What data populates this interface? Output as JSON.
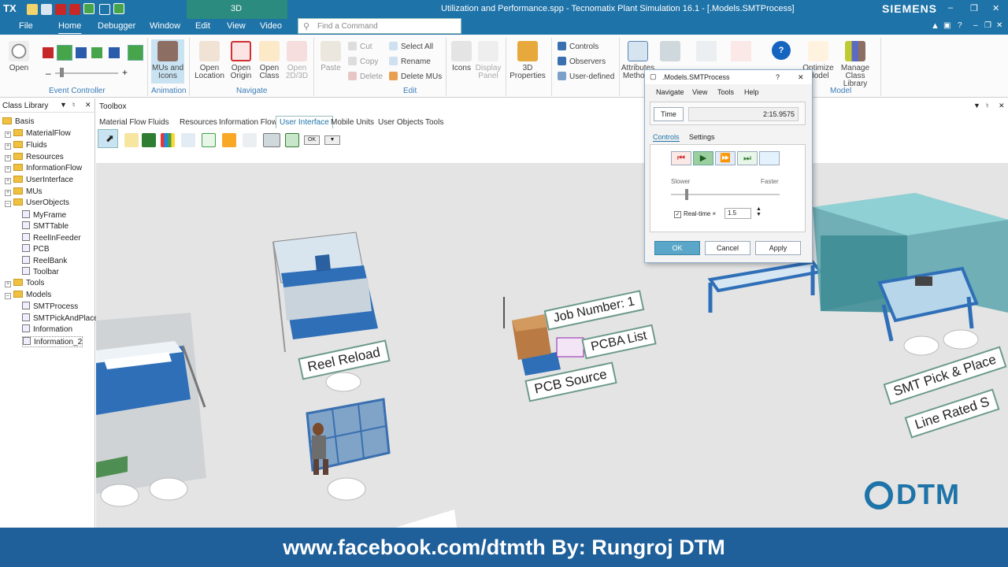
{
  "titlebar": {
    "logo": "TX",
    "title": "Utilization and Performance.spp - Tecnomatix Plant Simulation 16.1 - [.Models.SMTProcess]",
    "brand": "SIEMENS",
    "context_tab": "3D",
    "window_controls": [
      "–",
      "❐",
      "✕"
    ],
    "doc_controls": [
      "–",
      "❐",
      "✕"
    ]
  },
  "menubar": {
    "items": [
      "File",
      "Home",
      "Debugger",
      "Window",
      "Edit",
      "View",
      "Video"
    ],
    "active": "Home",
    "search_placeholder": "Find a Command"
  },
  "ribbon": {
    "event_controller": {
      "open_label": "Open",
      "slider_minus": "–",
      "slider_plus": "+",
      "group": "Event Controller"
    },
    "animation": {
      "mus_icons_label": "MUs and Icons",
      "group": "Animation"
    },
    "navigate": {
      "open_location": "Open Location",
      "open_origin": "Open Origin",
      "open_class": "Open Class",
      "open_2d3d": "Open 2D/3D",
      "group": "Navigate"
    },
    "edit": {
      "paste": "Paste",
      "cut": "Cut",
      "copy": "Copy",
      "delete": "Delete",
      "select_all": "Select All",
      "rename": "Rename",
      "delete_mus": "Delete MUs",
      "group": "Edit"
    },
    "display": {
      "icons": "Icons",
      "display_panel": "Display Panel"
    },
    "properties": {
      "three_d": "3D Properties"
    },
    "controls_group": {
      "controls": "Controls",
      "observers": "Observers",
      "user_defined": "User-defined"
    },
    "attributes": {
      "label": "Attributes Methods"
    },
    "model": {
      "optimize": "Optimize Model",
      "manage": "Manage Class Library",
      "group": "Model"
    }
  },
  "class_library": {
    "title": "Class Library",
    "items": [
      {
        "label": "Basis",
        "kind": "folder"
      },
      {
        "label": "MaterialFlow",
        "kind": "folder"
      },
      {
        "label": "Fluids",
        "kind": "folder"
      },
      {
        "label": "Resources",
        "kind": "folder"
      },
      {
        "label": "InformationFlow",
        "kind": "folder"
      },
      {
        "label": "UserInterface",
        "kind": "folder"
      },
      {
        "label": "MUs",
        "kind": "folder"
      },
      {
        "label": "UserObjects",
        "kind": "folder"
      },
      {
        "label": "MyFrame",
        "kind": "doc"
      },
      {
        "label": "SMTTable",
        "kind": "doc"
      },
      {
        "label": "ReelInFeeder",
        "kind": "doc"
      },
      {
        "label": "PCB",
        "kind": "doc"
      },
      {
        "label": "ReelBank",
        "kind": "doc"
      },
      {
        "label": "Toolbar",
        "kind": "doc"
      },
      {
        "label": "Tools",
        "kind": "folder"
      },
      {
        "label": "Models",
        "kind": "folder"
      },
      {
        "label": "SMTProcess",
        "kind": "doc"
      },
      {
        "label": "SMTPickAndPlace",
        "kind": "doc"
      },
      {
        "label": "Information",
        "kind": "doc"
      },
      {
        "label": "Information_2",
        "kind": "doc"
      }
    ]
  },
  "toolbox": {
    "title": "Toolbox",
    "tabs": [
      "Material Flow",
      "Fluids",
      "Resources",
      "Information Flow",
      "User Interface",
      "Mobile Units",
      "User Objects",
      "Tools"
    ],
    "active_tab": "User Interface",
    "ok_button": "OK"
  },
  "scene": {
    "labels": {
      "reel_reload": "Reel Reload",
      "job_number": "Job Number: 1",
      "pcba_list": "PCBA List",
      "pcb_source": "PCB Source",
      "smt_pick": "SMT Pick & Place",
      "line_rated": "Line Rated S"
    },
    "watermark": "DTM"
  },
  "dialog": {
    "title": ".Models.SMTProcess",
    "help": "?",
    "close": "✕",
    "menu": [
      "Navigate",
      "View",
      "Tools",
      "Help"
    ],
    "time_label": "Time",
    "time_value": "2:15.9575",
    "tabs": [
      "Controls",
      "Settings"
    ],
    "slower": "Slower",
    "faster": "Faster",
    "realtime_label": "Real-time ×",
    "realtime_value": "1.5",
    "ok": "OK",
    "cancel": "Cancel",
    "apply": "Apply"
  },
  "footer": {
    "text": "www.facebook.com/dtmth  By: Rungroj DTM"
  }
}
